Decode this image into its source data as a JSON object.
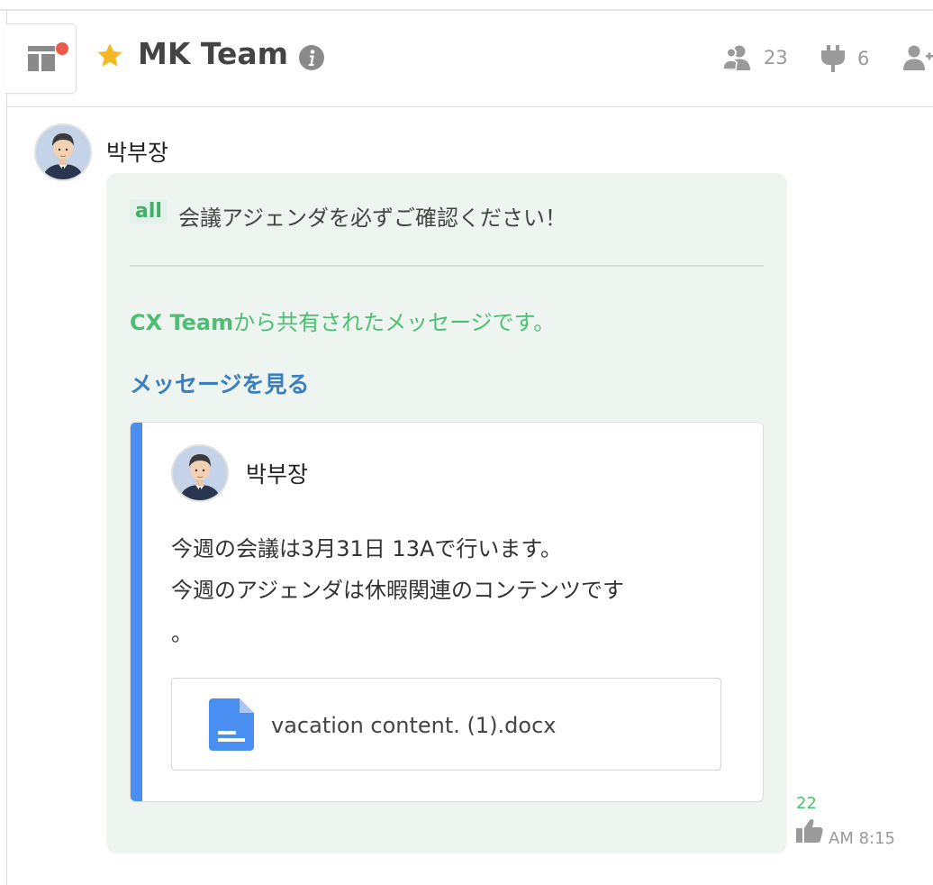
{
  "header": {
    "title": "MK Team",
    "members_count": "23",
    "pinned_count": "6"
  },
  "message": {
    "sender": "박부장",
    "mention": "all",
    "text": "会議アジェンダを必ずご確認ください！",
    "shared_from_team": "CX Team",
    "shared_from_suffix": "から共有されたメッセージです。",
    "view_link": "メッセージを見る",
    "quoted": {
      "sender": "박부장",
      "lines": [
        "今週の会議は3月31日 13Aで行います。",
        "今週のアジェンダは休暇関連のコンテンツです",
        "。"
      ],
      "file_name": "vacation content. (1).docx"
    },
    "reaction_count": "22",
    "time": "AM 8:15"
  },
  "colors": {
    "accent_green": "#4cbf73",
    "link_blue": "#3a7fc1",
    "quote_bar": "#4a8ef2",
    "notification_dot": "#ee5a4a",
    "star": "#f5b723",
    "bubble_bg": "#eef5f1"
  },
  "icons": {
    "layout": "layout-icon",
    "star": "star-icon",
    "info": "info-icon",
    "members": "members-icon",
    "pin": "pin-icon",
    "add_member": "add-member-icon",
    "file": "docx-file-icon",
    "like": "thumbs-up-icon"
  }
}
